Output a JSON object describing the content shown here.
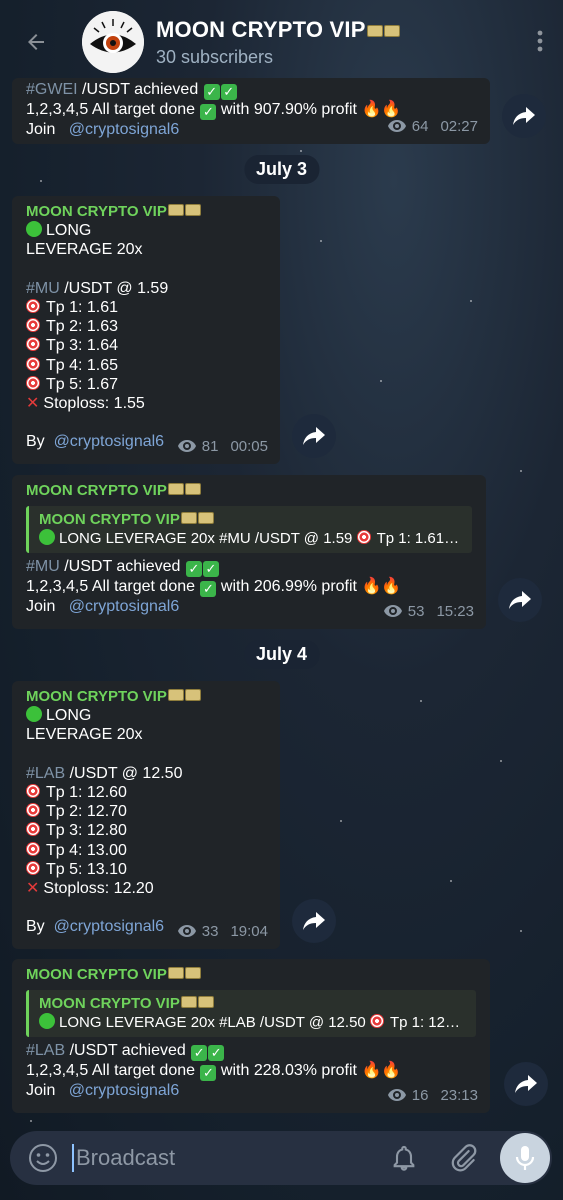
{
  "header": {
    "title": "MOON CRYPTO VIP",
    "subtitle": "30 subscribers"
  },
  "dates": [
    "July 3",
    "July 4"
  ],
  "messages": [
    {
      "lines": [
        "#GWEI",
        " /USDT achieved",
        "1,2,3,4,5 All target done",
        " with 907.90% profit",
        "Join",
        "@cryptosignal6"
      ],
      "views": "64",
      "time": "02:27"
    },
    {
      "sender": "MOON CRYPTO VIP",
      "long": "LONG",
      "leverage": "LEVERAGE 20x",
      "pair_tag": "#MU",
      "pair_rest": " /USDT @ 1.59",
      "tps": [
        "Tp 1: 1.61",
        "Tp 2: 1.63",
        "Tp 3: 1.64",
        "Tp 4: 1.65",
        "Tp 5: 1.67"
      ],
      "stoploss": "Stoploss: 1.55",
      "by": "By",
      "mention": "@cryptosignal6",
      "views": "81",
      "time": "00:05"
    },
    {
      "sender": "MOON CRYPTO VIP",
      "reply_sender": "MOON CRYPTO VIP",
      "reply_text": "LONG  LEVERAGE 20x  #MU  /USDT @ 1.59",
      "reply_tail": "Tp 1: 1.61…",
      "tag": "#MU",
      "achieved": " /USDT achieved",
      "done": "1,2,3,4,5 All target done",
      "profit": " with 206.99% profit",
      "join": "Join",
      "mention": "@cryptosignal6",
      "views": "53",
      "time": "15:23"
    },
    {
      "sender": "MOON CRYPTO VIP",
      "long": "LONG",
      "leverage": "LEVERAGE 20x",
      "pair_tag": "#LAB",
      "pair_rest": " /USDT @ 12.50",
      "tps": [
        "Tp 1: 12.60",
        "Tp 2: 12.70",
        "Tp 3: 12.80",
        "Tp 4: 13.00",
        "Tp 5: 13.10"
      ],
      "stoploss": "Stoploss: 12.20",
      "by": "By",
      "mention": "@cryptosignal6",
      "views": "33",
      "time": "19:04"
    },
    {
      "sender": "MOON CRYPTO VIP",
      "reply_sender": "MOON CRYPTO VIP",
      "reply_text": "LONG  LEVERAGE 20x  #LAB  /USDT @ 12.50",
      "reply_tail": "Tp 1: 12…",
      "tag": "#LAB",
      "achieved": " /USDT achieved",
      "done": "1,2,3,4,5 All target done",
      "profit": " with 228.03% profit",
      "join": "Join",
      "mention": "@cryptosignal6",
      "views": "16",
      "time": "23:13"
    }
  ],
  "input": {
    "placeholder": "Broadcast"
  },
  "icons": {
    "back": "back-arrow-icon",
    "menu": "more-vertical-icon",
    "forward": "forward-share-icon",
    "views": "eye-icon",
    "emoji": "emoji-icon",
    "bell": "bell-icon",
    "attach": "paperclip-icon",
    "mic": "microphone-icon"
  },
  "colors": {
    "accent_green": "#6fd35c",
    "bubble": "#202428",
    "hashtag": "#7e92a6",
    "mention": "#7ea5d6"
  }
}
